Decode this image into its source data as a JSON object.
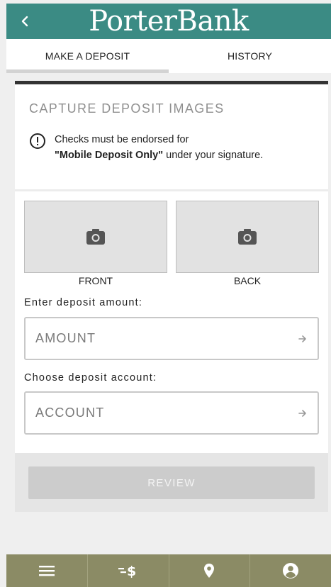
{
  "header": {
    "logo_text": "PorterBank",
    "back_icon": "chevron-left-icon"
  },
  "tabs": [
    {
      "label": "MAKE A DEPOSIT",
      "active": true
    },
    {
      "label": "HISTORY",
      "active": false
    }
  ],
  "deposit": {
    "section_title": "CAPTURE DEPOSIT IMAGES",
    "notice": {
      "icon": "exclamation-circle-icon",
      "line1": "Checks must be endorsed for",
      "bold": "\"Mobile Deposit Only\"",
      "line2_rest": " under your signature."
    },
    "capture": {
      "front_label": "FRONT",
      "back_label": "BACK",
      "icon": "camera-icon"
    },
    "amount": {
      "label": "Enter deposit amount:",
      "placeholder": "AMOUNT"
    },
    "account": {
      "label": "Choose deposit account:",
      "placeholder": "ACCOUNT"
    },
    "review_label": "REVIEW"
  },
  "bottom_nav": [
    {
      "icon": "menu-icon"
    },
    {
      "icon": "transfer-money-icon"
    },
    {
      "icon": "location-pin-icon"
    },
    {
      "icon": "user-account-icon"
    }
  ],
  "colors": {
    "header": "#3b8b84",
    "bottom_nav": "#8b8b65",
    "review_button": "#cccccc"
  }
}
